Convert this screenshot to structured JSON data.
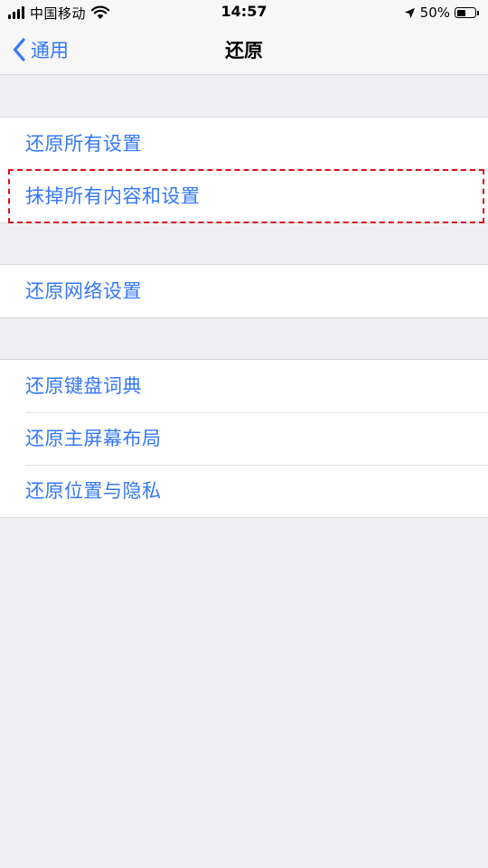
{
  "status_bar": {
    "carrier": "中国移动",
    "time": "14:57",
    "battery_percent": "50%",
    "battery_level": 0.5,
    "icons": [
      "signal-icon",
      "wifi-icon",
      "location-icon",
      "battery-icon"
    ]
  },
  "nav": {
    "back_label": "通用",
    "title": "还原"
  },
  "groups": [
    {
      "items": [
        "还原所有设置",
        "抹掉所有内容和设置"
      ]
    },
    {
      "items": [
        "还原网络设置"
      ]
    },
    {
      "items": [
        "还原键盘词典",
        "还原主屏幕布局",
        "还原位置与隐私"
      ]
    }
  ],
  "colors": {
    "link_blue": "#3478f6",
    "highlight_red": "#d9131d",
    "background": "#efeff4"
  }
}
